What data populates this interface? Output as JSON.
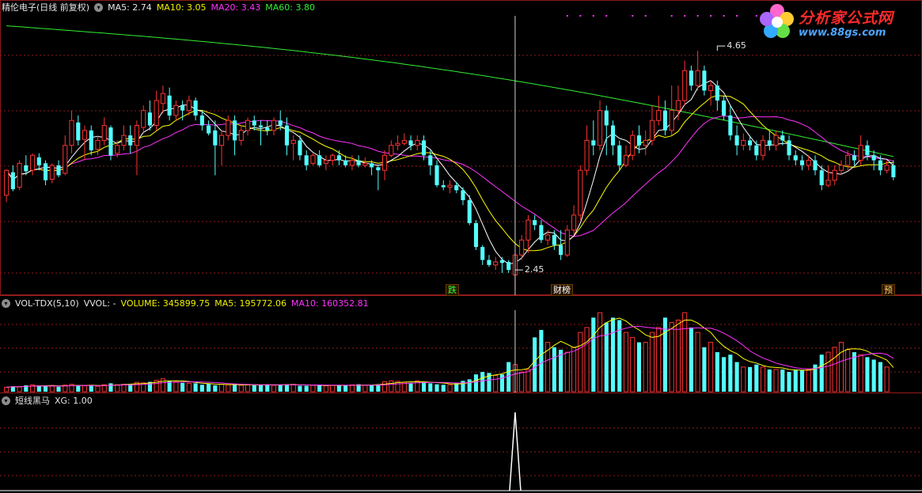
{
  "main_panel": {
    "stock_label": "精伦电子(日线 前复权)",
    "ma5": "MA5: 2.74",
    "ma10": "MA10: 3.05",
    "ma20": "MA20: 3.43",
    "ma60": "MA60: 3.80",
    "high_label": "4.65",
    "low_label": "2.45",
    "marker_down": "跌",
    "marker_fin": "财榜",
    "marker_pre": "预"
  },
  "volume_panel": {
    "indicator": "VOL-TDX(5,10)",
    "vvol": "VVOL: -",
    "volume": "VOLUME: 345899.75",
    "ma5": "MA5: 195772.06",
    "ma10": "MA10: 160352.81"
  },
  "signal_panel": {
    "name": "短线黑马",
    "xg": "XG: 1.00"
  },
  "logo": {
    "name": "分析家公式网",
    "url": "www.88gs.com"
  },
  "colors": {
    "up": "#ff3333",
    "down": "#54ffff",
    "ma5": "#ffffff",
    "ma10": "#ffff00",
    "ma20": "#ff33ff",
    "ma60": "#33ee33",
    "grid": "#8b1a1a"
  },
  "chart_data": [
    {
      "type": "candlestick",
      "title": "精伦电子(日线 前复权)",
      "y_range": [
        2.3,
        5.0
      ],
      "candles": [
        [
          3.2,
          3.45,
          3.13,
          3.46
        ],
        [
          3.43,
          3.26,
          3.24,
          3.5
        ],
        [
          3.28,
          3.52,
          3.25,
          3.55
        ],
        [
          3.5,
          3.44,
          3.4,
          3.6
        ],
        [
          3.45,
          3.6,
          3.4,
          3.62
        ],
        [
          3.58,
          3.5,
          3.45,
          3.62
        ],
        [
          3.52,
          3.35,
          3.3,
          3.55
        ],
        [
          3.36,
          3.5,
          3.32,
          3.52
        ],
        [
          3.5,
          3.4,
          3.38,
          3.55
        ],
        [
          3.42,
          3.7,
          3.4,
          3.8
        ],
        [
          3.7,
          3.95,
          3.62,
          4.05
        ],
        [
          3.93,
          3.75,
          3.7,
          4.0
        ],
        [
          3.76,
          3.85,
          3.55,
          3.9
        ],
        [
          3.85,
          3.65,
          3.6,
          3.9
        ],
        [
          3.66,
          3.75,
          3.6,
          3.8
        ],
        [
          3.75,
          3.9,
          3.7,
          3.98
        ],
        [
          3.88,
          3.6,
          3.55,
          3.9
        ],
        [
          3.62,
          3.7,
          3.58,
          3.75
        ],
        [
          3.7,
          3.8,
          3.65,
          3.9
        ],
        [
          3.8,
          3.7,
          3.62,
          3.9
        ],
        [
          3.7,
          3.9,
          3.4,
          3.95
        ],
        [
          3.88,
          4.05,
          3.83,
          4.1
        ],
        [
          4.03,
          3.9,
          3.85,
          4.15
        ],
        [
          3.9,
          4.15,
          3.85,
          4.25
        ],
        [
          4.12,
          4.22,
          4.02,
          4.3
        ],
        [
          4.2,
          4.0,
          3.95,
          4.28
        ],
        [
          4.0,
          4.1,
          3.95,
          4.15
        ],
        [
          4.1,
          4.05,
          3.95,
          4.15
        ],
        [
          4.05,
          4.15,
          4.0,
          4.2
        ],
        [
          4.15,
          4.0,
          3.95,
          4.18
        ],
        [
          4.0,
          3.9,
          3.85,
          4.05
        ],
        [
          3.9,
          3.82,
          3.8,
          3.95
        ],
        [
          3.85,
          3.7,
          3.4,
          3.95
        ],
        [
          3.7,
          3.8,
          3.5,
          3.85
        ],
        [
          3.8,
          3.95,
          3.75,
          4.0
        ],
        [
          3.95,
          3.75,
          3.6,
          4.0
        ],
        [
          3.75,
          3.85,
          3.7,
          3.9
        ],
        [
          3.85,
          3.95,
          3.8,
          3.98
        ],
        [
          3.95,
          3.9,
          3.85,
          4.0
        ],
        [
          3.9,
          3.88,
          3.7,
          3.95
        ],
        [
          3.88,
          3.85,
          3.8,
          3.95
        ],
        [
          3.85,
          3.95,
          3.8,
          3.98
        ],
        [
          3.95,
          3.9,
          3.85,
          4.05
        ],
        [
          3.9,
          3.7,
          3.6,
          3.98
        ],
        [
          3.72,
          3.75,
          3.55,
          3.8
        ],
        [
          3.75,
          3.6,
          3.55,
          3.8
        ],
        [
          3.6,
          3.5,
          3.45,
          3.65
        ],
        [
          3.52,
          3.6,
          3.5,
          3.62
        ],
        [
          3.6,
          3.5,
          3.48,
          3.65
        ],
        [
          3.52,
          3.55,
          3.45,
          3.6
        ],
        [
          3.55,
          3.6,
          3.5,
          3.62
        ],
        [
          3.6,
          3.55,
          3.5,
          3.65
        ],
        [
          3.55,
          3.5,
          3.48,
          3.6
        ],
        [
          3.5,
          3.55,
          3.45,
          3.6
        ],
        [
          3.55,
          3.5,
          3.48,
          3.6
        ],
        [
          3.5,
          3.52,
          3.48,
          3.58
        ],
        [
          3.52,
          3.48,
          3.4,
          3.55
        ],
        [
          3.48,
          3.45,
          3.25,
          3.5
        ],
        [
          3.45,
          3.6,
          3.35,
          3.65
        ],
        [
          3.6,
          3.7,
          3.58,
          3.75
        ],
        [
          3.7,
          3.72,
          3.65,
          3.8
        ],
        [
          3.72,
          3.75,
          3.7,
          3.82
        ],
        [
          3.75,
          3.7,
          3.65,
          3.8
        ],
        [
          3.7,
          3.75,
          3.65,
          3.8
        ],
        [
          3.75,
          3.6,
          3.55,
          3.8
        ],
        [
          3.6,
          3.5,
          3.4,
          3.65
        ],
        [
          3.5,
          3.3,
          3.28,
          3.55
        ],
        [
          3.3,
          3.28,
          3.25,
          3.35
        ],
        [
          3.28,
          3.3,
          3.22,
          3.35
        ],
        [
          3.3,
          3.25,
          3.22,
          3.33
        ],
        [
          3.25,
          3.15,
          3.1,
          3.28
        ],
        [
          3.15,
          2.92,
          2.9,
          3.2
        ],
        [
          2.92,
          2.68,
          2.65,
          2.95
        ],
        [
          2.68,
          2.55,
          2.5,
          2.7
        ],
        [
          2.55,
          2.5,
          2.48,
          2.6
        ],
        [
          2.5,
          2.53,
          2.45,
          2.58
        ],
        [
          2.55,
          2.52,
          2.42,
          2.58
        ],
        [
          2.53,
          2.45,
          2.42,
          2.55
        ],
        [
          2.4,
          2.6,
          2.25,
          2.62
        ],
        [
          2.6,
          2.75,
          2.55,
          2.8
        ],
        [
          2.75,
          2.95,
          2.62,
          3.0
        ],
        [
          2.95,
          2.9,
          2.85,
          3.0
        ],
        [
          2.9,
          2.75,
          2.72,
          2.95
        ],
        [
          2.75,
          2.8,
          2.7,
          2.85
        ],
        [
          2.8,
          2.7,
          2.65,
          2.85
        ],
        [
          2.7,
          2.6,
          2.55,
          2.85
        ],
        [
          2.6,
          2.85,
          2.58,
          2.9
        ],
        [
          2.85,
          3.0,
          2.8,
          3.1
        ],
        [
          3.0,
          3.45,
          2.95,
          3.5
        ],
        [
          3.45,
          3.75,
          3.4,
          3.9
        ],
        [
          3.75,
          3.7,
          3.6,
          3.95
        ],
        [
          3.7,
          4.05,
          3.65,
          4.15
        ],
        [
          4.05,
          3.9,
          3.6,
          4.1
        ],
        [
          3.9,
          3.7,
          3.6,
          3.95
        ],
        [
          3.7,
          3.5,
          3.45,
          3.75
        ],
        [
          3.5,
          3.6,
          3.48,
          3.7
        ],
        [
          3.6,
          3.8,
          3.55,
          3.85
        ],
        [
          3.8,
          3.7,
          3.62,
          3.9
        ],
        [
          3.7,
          3.75,
          3.6,
          3.85
        ],
        [
          3.75,
          3.95,
          3.7,
          4.1
        ],
        [
          3.95,
          4.05,
          3.9,
          4.2
        ],
        [
          4.05,
          3.85,
          3.8,
          4.15
        ],
        [
          3.85,
          4.05,
          3.8,
          4.3
        ],
        [
          4.05,
          4.15,
          3.95,
          4.3
        ],
        [
          4.15,
          4.45,
          4.1,
          4.55
        ],
        [
          4.45,
          4.3,
          4.25,
          4.5
        ],
        [
          4.3,
          4.45,
          4.25,
          4.65
        ],
        [
          4.45,
          4.25,
          4.2,
          4.5
        ],
        [
          4.25,
          4.3,
          4.1,
          4.35
        ],
        [
          4.3,
          4.15,
          4.05,
          4.35
        ],
        [
          4.15,
          4.0,
          3.95,
          4.2
        ],
        [
          4.0,
          3.8,
          3.75,
          4.1
        ],
        [
          3.8,
          3.7,
          3.6,
          3.9
        ],
        [
          3.7,
          3.75,
          3.65,
          3.82
        ],
        [
          3.75,
          3.7,
          3.65,
          3.8
        ],
        [
          3.7,
          3.6,
          3.55,
          3.75
        ],
        [
          3.6,
          3.75,
          3.55,
          3.8
        ],
        [
          3.75,
          3.7,
          3.65,
          3.85
        ],
        [
          3.7,
          3.8,
          3.65,
          3.85
        ],
        [
          3.8,
          3.75,
          3.7,
          3.85
        ],
        [
          3.75,
          3.6,
          3.55,
          3.8
        ],
        [
          3.6,
          3.55,
          3.5,
          3.65
        ],
        [
          3.55,
          3.5,
          3.45,
          3.6
        ],
        [
          3.5,
          3.55,
          3.45,
          3.6
        ],
        [
          3.55,
          3.45,
          3.4,
          3.6
        ],
        [
          3.45,
          3.3,
          3.25,
          3.5
        ],
        [
          3.3,
          3.35,
          3.28,
          3.5
        ],
        [
          3.35,
          3.45,
          3.3,
          3.5
        ],
        [
          3.45,
          3.5,
          3.4,
          3.55
        ],
        [
          3.5,
          3.6,
          3.45,
          3.65
        ],
        [
          3.6,
          3.55,
          3.5,
          3.65
        ],
        [
          3.55,
          3.7,
          3.5,
          3.8
        ],
        [
          3.7,
          3.6,
          3.55,
          3.75
        ],
        [
          3.6,
          3.55,
          3.45,
          3.65
        ],
        [
          3.55,
          3.45,
          3.4,
          3.6
        ],
        [
          3.45,
          3.5,
          3.42,
          3.55
        ],
        [
          3.5,
          3.38,
          3.35,
          3.55
        ]
      ],
      "annotations": [
        {
          "text": "4.65",
          "index": 109,
          "price": 4.65
        },
        {
          "text": "2.45",
          "index": 78,
          "price": 2.45
        }
      ]
    },
    {
      "type": "bar",
      "title": "VOL-TDX(5,10)",
      "note": "volume in same time order; positive = up day, negative = down day",
      "values": [
        18,
        22,
        20,
        26,
        28,
        24,
        22,
        25,
        20,
        27,
        30,
        26,
        24,
        24,
        22,
        28,
        34,
        28,
        30,
        32,
        38,
        36,
        40,
        46,
        52,
        44,
        40,
        36,
        34,
        34,
        28,
        32,
        26,
        30,
        28,
        30,
        26,
        28,
        26,
        28,
        30,
        26,
        28,
        30,
        30,
        24,
        24,
        26,
        28,
        24,
        26,
        26,
        24,
        28,
        30,
        26,
        28,
        30,
        40,
        44,
        42,
        38,
        36,
        44,
        40,
        34,
        30,
        28,
        28,
        34,
        44,
        50,
        70,
        80,
        76,
        66,
        70,
        120,
        110,
        80,
        90,
        220,
        250,
        200,
        180,
        170,
        160,
        180,
        240,
        260,
        300,
        320,
        280,
        300,
        290,
        240,
        220,
        200,
        200,
        240,
        260,
        300,
        280,
        290,
        320,
        260,
        240,
        180,
        200,
        160,
        140,
        150,
        120,
        100,
        100,
        110,
        100,
        90,
        90,
        90,
        80,
        90,
        86,
        90,
        110,
        150,
        160,
        180,
        200,
        170,
        160,
        150,
        140,
        130,
        120,
        100
      ]
    },
    {
      "type": "line",
      "title": "短线黑马",
      "signal_index": 78,
      "values": [
        1.0
      ]
    }
  ]
}
